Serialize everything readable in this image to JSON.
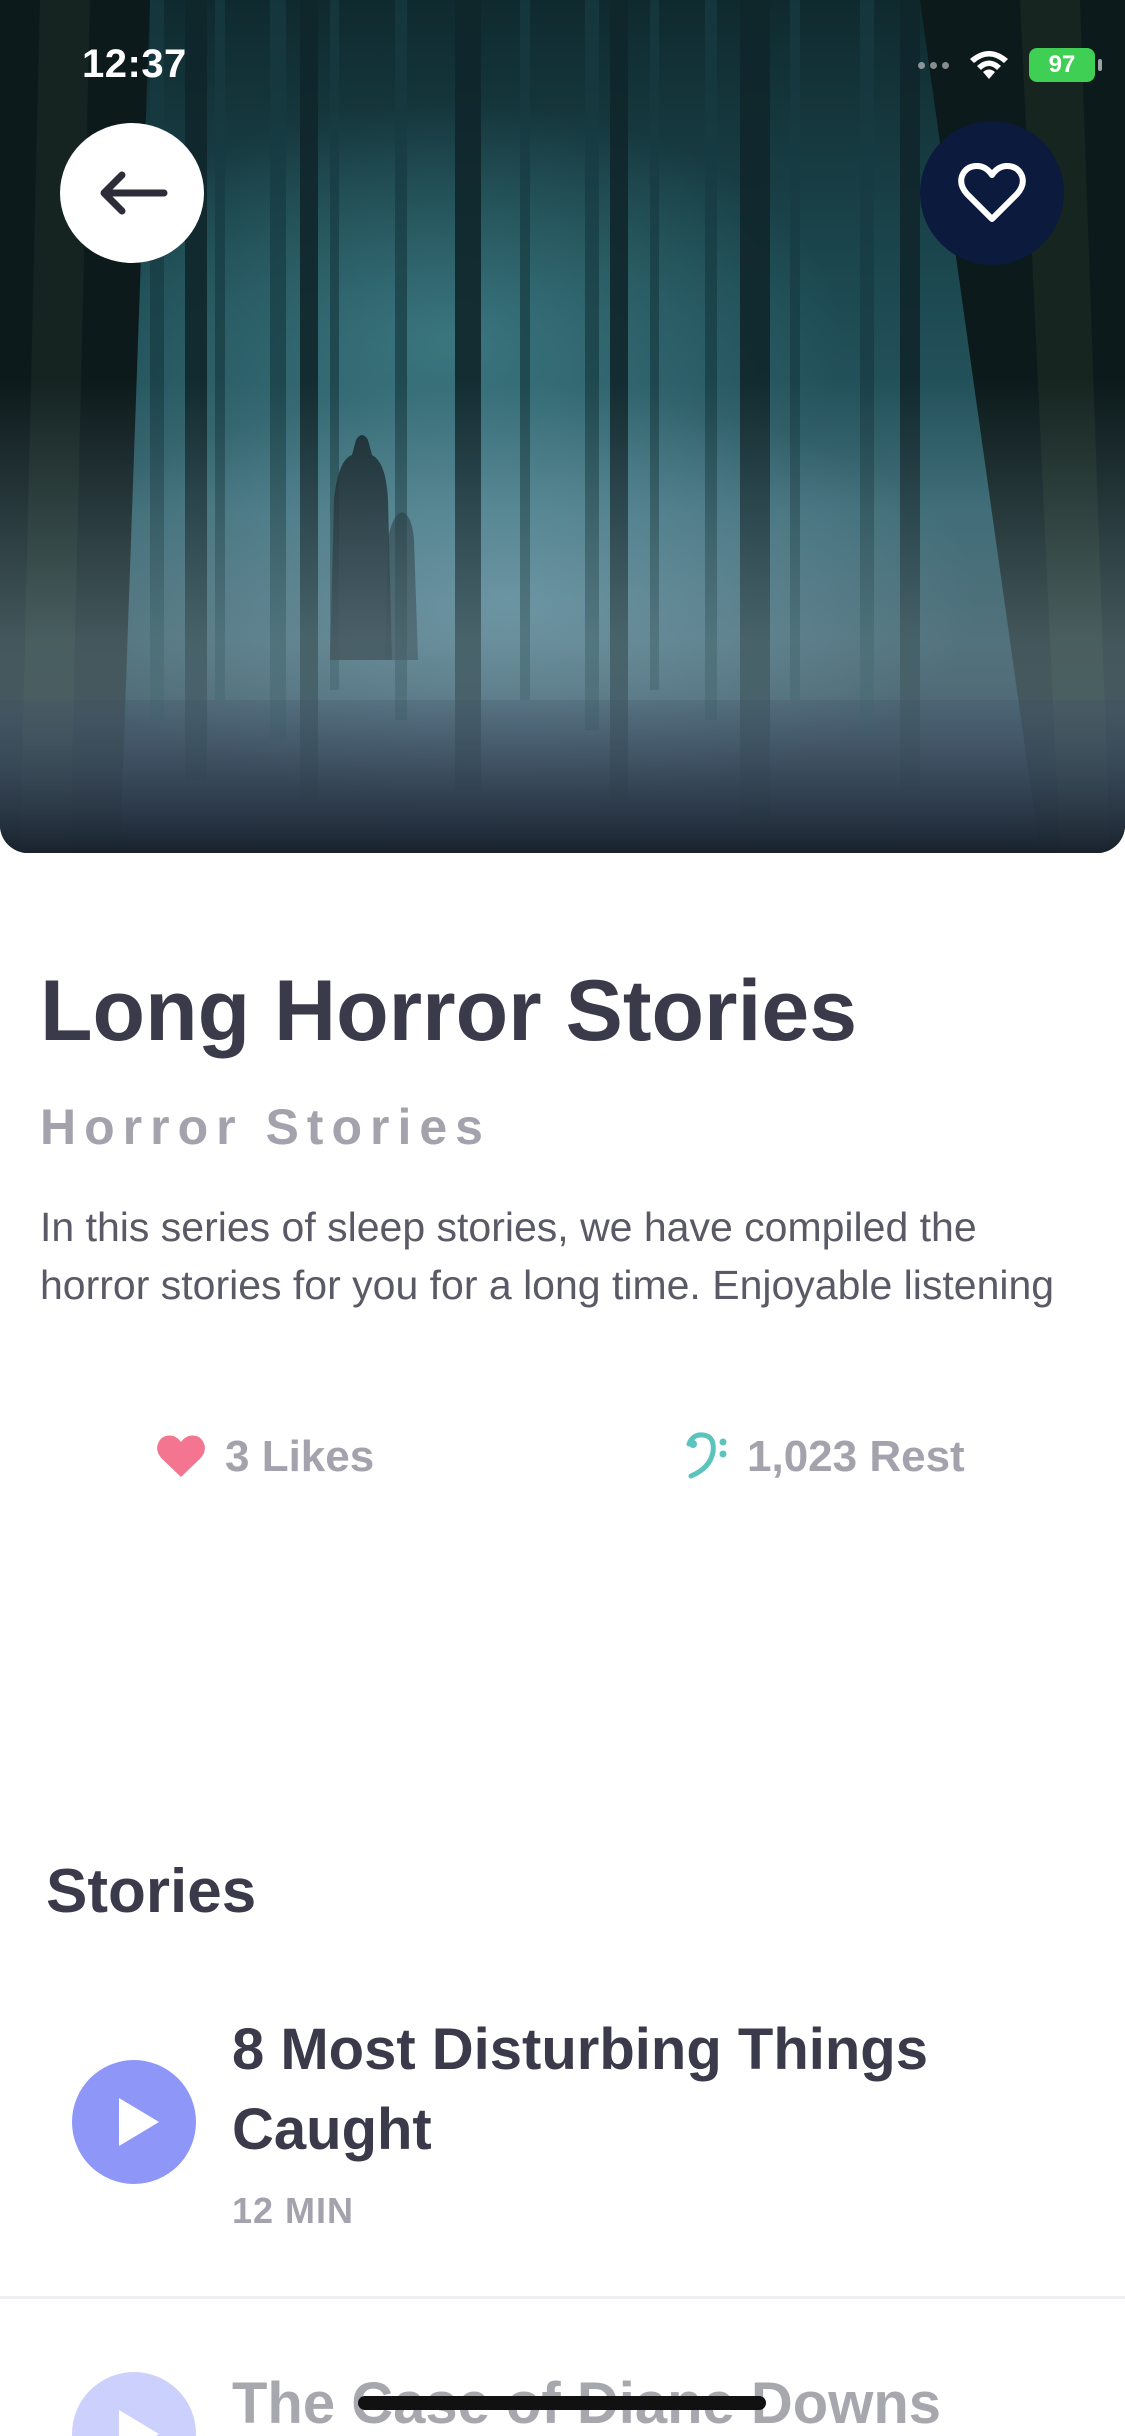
{
  "status_bar": {
    "time": "12:37",
    "battery": "97"
  },
  "header": {
    "back_icon": "arrow-left-icon",
    "favorite_icon": "heart-outline-icon"
  },
  "collection": {
    "title": "Long Horror Stories",
    "category": "Horror Stories",
    "description": "In this series of sleep stories, we have compiled the horror stories for you for a long time. Enjoyable listening",
    "likes_label": "3 Likes",
    "rest_label": "1,023 Rest"
  },
  "stories": {
    "heading": "Stories",
    "items": [
      {
        "title": "8 Most Disturbing Things Caught",
        "duration": "12 MIN"
      },
      {
        "title": "The Case of Diane Downs"
      }
    ]
  },
  "colors": {
    "accent": "#8e97f8",
    "heart": "#f3758f",
    "rest_icon": "#5cc4be",
    "favorite_button": "#0b1a3d",
    "battery": "#3ecf54"
  }
}
